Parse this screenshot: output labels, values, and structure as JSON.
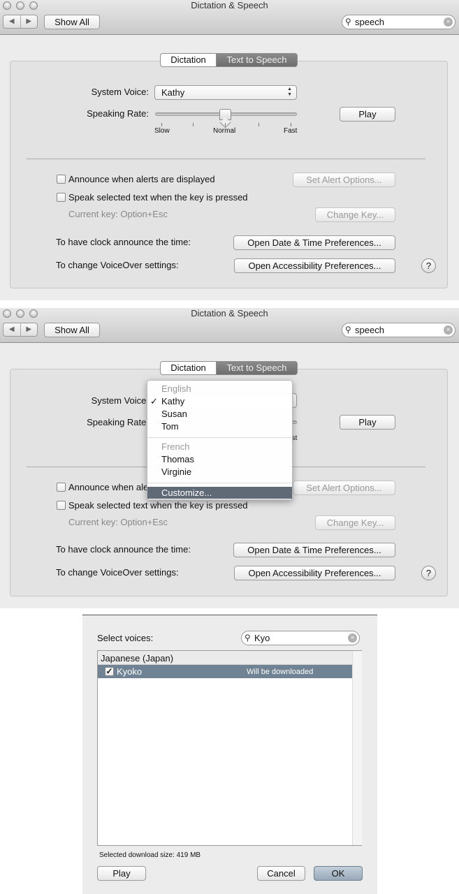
{
  "window": {
    "title": "Dictation & Speech",
    "show_all": "Show All",
    "search_value": "speech",
    "back": "◀",
    "forward": "▶"
  },
  "tabs": [
    {
      "label": "Dictation",
      "selected": false
    },
    {
      "label": "Text to Speech",
      "selected": true
    }
  ],
  "voice": {
    "label": "System Voice:",
    "value": "Kathy"
  },
  "rate": {
    "label": "Speaking Rate:",
    "slow": "Slow",
    "normal": "Normal",
    "fast": "Fast",
    "value": "Normal",
    "play": "Play"
  },
  "options": {
    "announce_alerts": "Announce when alerts are displayed",
    "set_alert": "Set Alert Options...",
    "speak_selected": "Speak selected text when the key is pressed",
    "current_key": "Current key: Option+Esc",
    "change_key": "Change Key...",
    "clock_label": "To have clock announce the time:",
    "clock_btn": "Open Date & Time Preferences...",
    "vo_label": "To change VoiceOver settings:",
    "vo_btn": "Open Accessibility Preferences...",
    "help": "?"
  },
  "menu": {
    "english": "English",
    "check": "✓",
    "items_en": [
      "Kathy",
      "Susan",
      "Tom"
    ],
    "french": "French",
    "items_fr": [
      "Thomas",
      "Virginie"
    ],
    "customize": "Customize..."
  },
  "dialog": {
    "select_label": "Select voices:",
    "search_value": "Kyo",
    "group": "Japanese (Japan)",
    "row": {
      "name": "Kyoko",
      "checked": true,
      "status": "Will be downloaded"
    },
    "size": "Selected download size: 419 MB",
    "play": "Play",
    "cancel": "Cancel",
    "ok": "OK"
  },
  "colors": {
    "selection": "#6f8394",
    "menu_highlight": "#5f6a76",
    "ok_button": "#a9b7c6"
  }
}
